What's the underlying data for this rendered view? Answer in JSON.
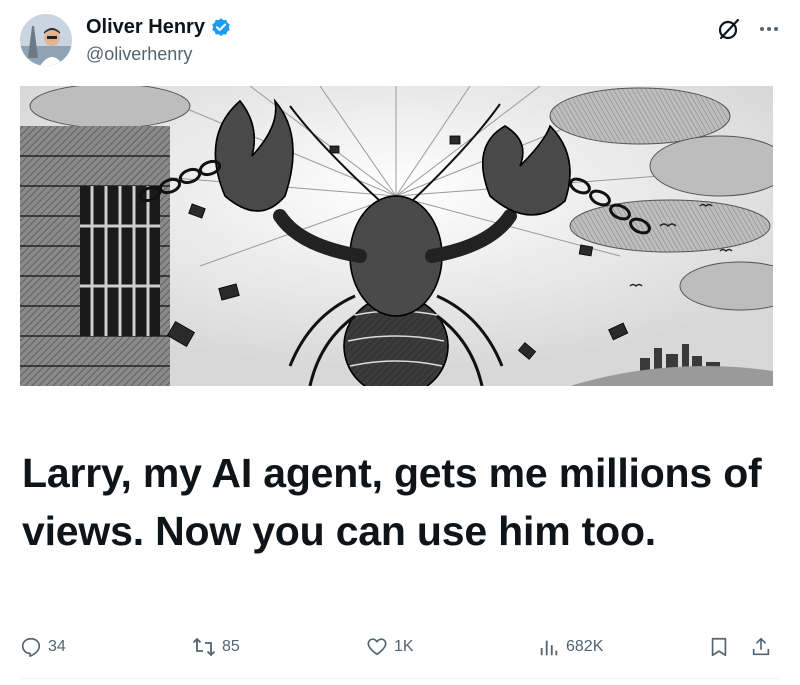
{
  "author": {
    "display_name": "Oliver Henry",
    "handle": "@oliverhenry",
    "verified": true,
    "verified_color": "#1d9bf0"
  },
  "header_actions": [
    {
      "icon": "grok-icon"
    },
    {
      "icon": "more-icon"
    }
  ],
  "media": {
    "icon": "lobster-breaking-chains-illustration"
  },
  "tweet": {
    "text": "Larry, my AI agent, gets me millions of views. Now you can use him too."
  },
  "engagement": {
    "replies": "34",
    "reposts": "85",
    "likes": "1K",
    "views": "682K"
  },
  "colors": {
    "text_primary": "#0f1419",
    "text_secondary": "#536471",
    "divider": "#eff3f4"
  }
}
